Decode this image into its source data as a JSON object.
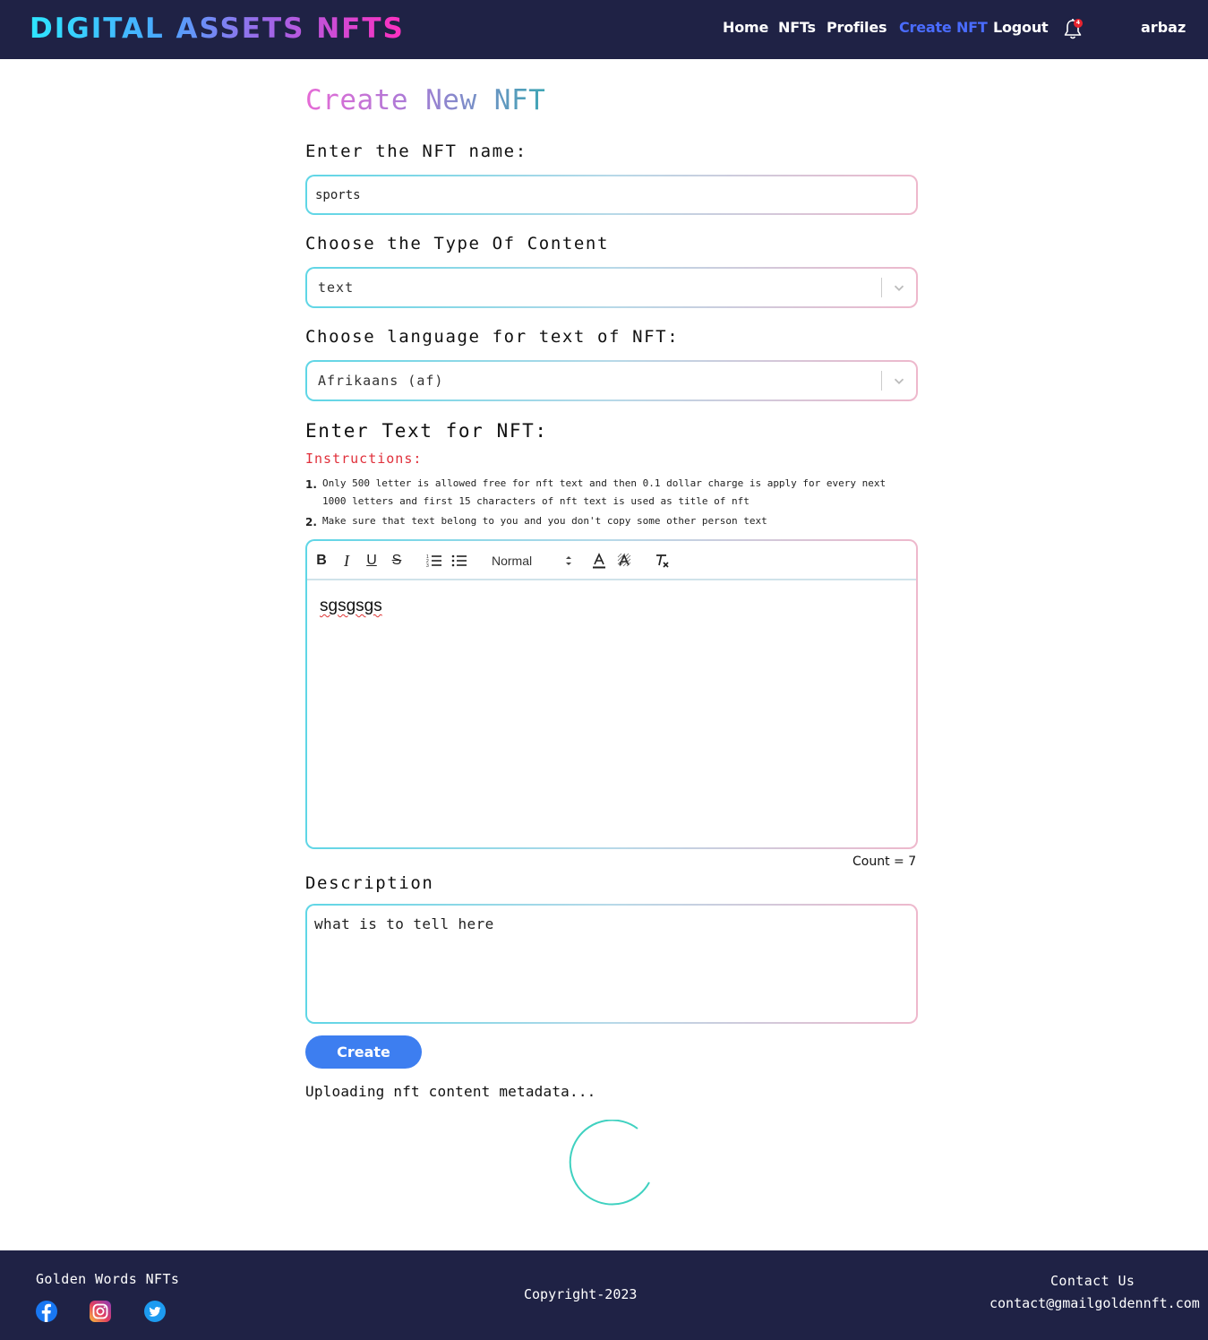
{
  "header": {
    "brand": "DIGITAL ASSETS NFTS",
    "nav": [
      "Home",
      "NFTs",
      "Profiles",
      "Create NFT",
      "Logout"
    ],
    "active_nav": "Create NFT",
    "notification_count": "4",
    "user": "arbaz"
  },
  "form": {
    "title": "Create New NFT",
    "name_label": "Enter the NFT name:",
    "name_value": "sports",
    "content_type_label": "Choose the Type Of Content",
    "content_type_value": "text",
    "language_label": "Choose language for text of NFT:",
    "language_value": "Afrikaans (af)",
    "text_label": "Enter Text for NFT:",
    "instructions_title": "Instructions:",
    "instructions": [
      "Only 500 letter is allowed free for nft text and then 0.1 dollar charge is apply for every next 1000 letters and first 15 characters of nft text is used as title of nft",
      "Make sure that text belong to you and you don't copy some other person text"
    ],
    "editor": {
      "size_option": "Normal",
      "content": "sgsgsgs"
    },
    "count_text": "Count = 7",
    "description_label": "Description",
    "description_value": "what is to tell here",
    "create_button": "Create",
    "status": "Uploading nft content metadata..."
  },
  "footer": {
    "brand": "Golden Words NFTs",
    "copyright": "Copyright-2023",
    "contact_title": "Contact Us",
    "contact_email": "contact@gmailgoldennft.com",
    "social_icons": [
      "facebook-icon",
      "instagram-icon",
      "twitter-icon"
    ]
  },
  "colors": {
    "header_bg": "#1f2245",
    "active_nav": "#4a6cff",
    "button": "#3d7ef0",
    "instructions": "#e0303b",
    "spinner": "#3fd1c0"
  }
}
